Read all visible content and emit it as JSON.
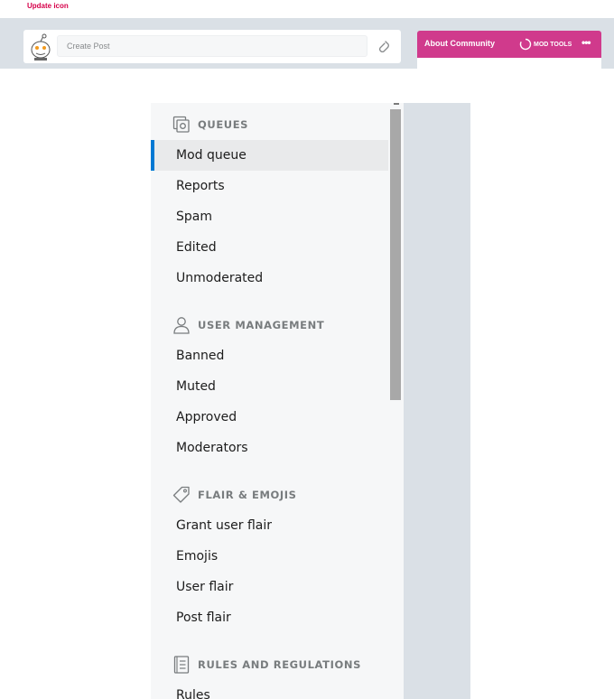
{
  "annotation": {
    "title": "Update icon"
  },
  "create_post": {
    "placeholder": "Create Post"
  },
  "about": {
    "title": "About Community",
    "mod_tools_label": "MOD TOOLS",
    "more_label": "•••"
  },
  "colors": {
    "accent": "#0079d3",
    "community_header": "#d03a8c",
    "annotation_red": "#e8003d"
  },
  "sidebar": {
    "sections": [
      {
        "label": "QUEUES",
        "icon": "queue-icon",
        "items": [
          "Mod queue",
          "Reports",
          "Spam",
          "Edited",
          "Unmoderated"
        ]
      },
      {
        "label": "USER MANAGEMENT",
        "icon": "user-icon",
        "items": [
          "Banned",
          "Muted",
          "Approved",
          "Moderators"
        ]
      },
      {
        "label": "FLAIR & EMOJIS",
        "icon": "tag-icon",
        "items": [
          "Grant user flair",
          "Emojis",
          "User flair",
          "Post flair"
        ]
      },
      {
        "label": "RULES AND REGULATIONS",
        "icon": "rules-icon",
        "items": [
          "Rules"
        ]
      }
    ],
    "active_item": "Mod queue"
  }
}
